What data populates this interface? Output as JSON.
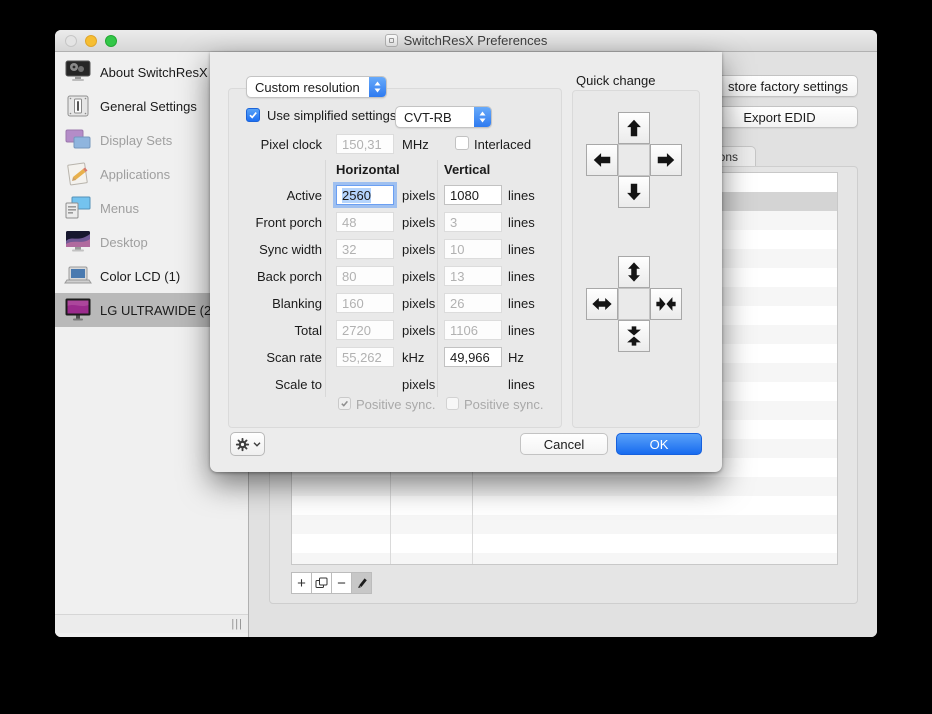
{
  "window": {
    "title": "SwitchResX Preferences"
  },
  "sidebar": {
    "items": [
      {
        "label": "About SwitchResX",
        "icon": "about-monitor-icon",
        "disabled": false,
        "selected": false
      },
      {
        "label": "General Settings",
        "icon": "switch-icon",
        "disabled": false,
        "selected": false
      },
      {
        "label": "Display Sets",
        "icon": "display-sets-icon",
        "disabled": true,
        "selected": false
      },
      {
        "label": "Applications",
        "icon": "applications-icon",
        "disabled": true,
        "selected": false
      },
      {
        "label": "Menus",
        "icon": "menus-icon",
        "disabled": true,
        "selected": false
      },
      {
        "label": "Desktop",
        "icon": "desktop-icon",
        "disabled": true,
        "selected": false
      },
      {
        "label": "Color LCD (1)",
        "icon": "laptop-icon",
        "disabled": false,
        "selected": false
      },
      {
        "label": "LG ULTRAWIDE (2",
        "icon": "ultrawide-monitor-icon",
        "disabled": false,
        "selected": true
      }
    ]
  },
  "background": {
    "restore_factory_label": "store factory settings",
    "export_edid_label": "Export EDID",
    "tab_label": "ions"
  },
  "dialog": {
    "preset_popup_value": "Custom resolution",
    "use_simplified_label": "Use simplified settings:",
    "timing_popup_value": "CVT-RB",
    "pixel_clock": {
      "label": "Pixel clock",
      "value": "150,31",
      "unit": "MHz"
    },
    "interlaced_label": "Interlaced",
    "columns": {
      "horizontal": "Horizontal",
      "vertical": "Vertical"
    },
    "rows": [
      {
        "label": "Active",
        "h": "2560",
        "hu": "pixels",
        "v": "1080",
        "vu": "lines"
      },
      {
        "label": "Front porch",
        "h": "48",
        "hu": "pixels",
        "v": "3",
        "vu": "lines"
      },
      {
        "label": "Sync width",
        "h": "32",
        "hu": "pixels",
        "v": "10",
        "vu": "lines"
      },
      {
        "label": "Back porch",
        "h": "80",
        "hu": "pixels",
        "v": "13",
        "vu": "lines"
      },
      {
        "label": "Blanking",
        "h": "160",
        "hu": "pixels",
        "v": "26",
        "vu": "lines"
      },
      {
        "label": "Total",
        "h": "2720",
        "hu": "pixels",
        "v": "1106",
        "vu": "lines"
      },
      {
        "label": "Scan rate",
        "h": "55,262",
        "hu": "kHz",
        "v": "49,966",
        "vu": "Hz"
      },
      {
        "label": "Scale to",
        "h": "",
        "hu": "pixels",
        "v": "",
        "vu": "lines"
      }
    ],
    "positive_sync_h_label": "Positive sync.",
    "positive_sync_v_label": "Positive sync.",
    "quick_change_label": "Quick change",
    "cancel_label": "Cancel",
    "ok_label": "OK"
  },
  "icons": {
    "plus": "+",
    "minus": "−",
    "grip": "|||",
    "gear": "gear-icon",
    "pencil": "pencil-icon",
    "duplicate": "duplicate-icon",
    "arrows": [
      "up",
      "left",
      "right",
      "down",
      "expand-vertical",
      "expand-horizontal",
      "collapse-horizontal",
      "collapse-vertical"
    ]
  },
  "colors": {
    "accent_blue": "#2e7af0",
    "ok_gradient_top": "#5aa2f9",
    "ok_gradient_bottom": "#176bef",
    "selected_sidebar_row": "#b9b9b9",
    "selected_table_row": "#d4d4d4",
    "focus_ring": "#78aaf5"
  }
}
